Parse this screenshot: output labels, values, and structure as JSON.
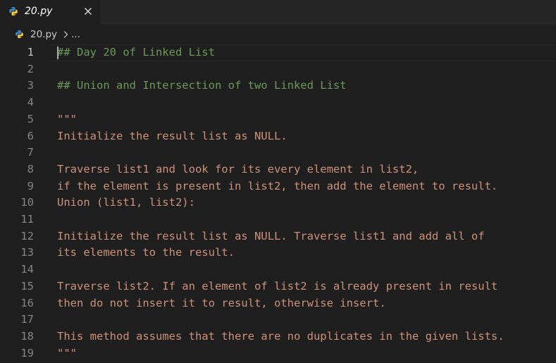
{
  "tab": {
    "filename": "20.py",
    "close_icon": "close-icon",
    "file_icon": "python-icon"
  },
  "breadcrumb": {
    "file": "20.py",
    "separator_icon": "chevron-right-icon",
    "more": "..."
  },
  "colors": {
    "background": "#1e1e1e",
    "tabbar": "#252526",
    "line_number": "#858585",
    "line_number_active": "#c6c6c6",
    "comment": "#6a9955",
    "string": "#ce9178"
  },
  "lines": [
    {
      "n": "1",
      "text": "## Day 20 of Linked List",
      "kind": "comment"
    },
    {
      "n": "2",
      "text": "",
      "kind": "blank"
    },
    {
      "n": "3",
      "text": "## Union and Intersection of two Linked List",
      "kind": "comment"
    },
    {
      "n": "4",
      "text": "",
      "kind": "blank"
    },
    {
      "n": "5",
      "text": "\"\"\"",
      "kind": "string"
    },
    {
      "n": "6",
      "text": "Initialize the result list as NULL.",
      "kind": "string"
    },
    {
      "n": "7",
      "text": "",
      "kind": "blank"
    },
    {
      "n": "8",
      "text": "Traverse list1 and look for its every element in list2,",
      "kind": "string"
    },
    {
      "n": "9",
      "text": "if the element is present in list2, then add the element to result.",
      "kind": "string"
    },
    {
      "n": "10",
      "text": "Union (list1, list2):",
      "kind": "string"
    },
    {
      "n": "11",
      "text": "",
      "kind": "blank"
    },
    {
      "n": "12",
      "text": "Initialize the result list as NULL. Traverse list1 and add all of",
      "kind": "string"
    },
    {
      "n": "13",
      "text": "its elements to the result.",
      "kind": "string"
    },
    {
      "n": "14",
      "text": "",
      "kind": "blank"
    },
    {
      "n": "15",
      "text": "Traverse list2. If an element of list2 is already present in result",
      "kind": "string"
    },
    {
      "n": "16",
      "text": "then do not insert it to result, otherwise insert.",
      "kind": "string"
    },
    {
      "n": "17",
      "text": "",
      "kind": "blank"
    },
    {
      "n": "18",
      "text": "This method assumes that there are no duplicates in the given lists.",
      "kind": "string"
    },
    {
      "n": "19",
      "text": "\"\"\"",
      "kind": "string"
    }
  ]
}
